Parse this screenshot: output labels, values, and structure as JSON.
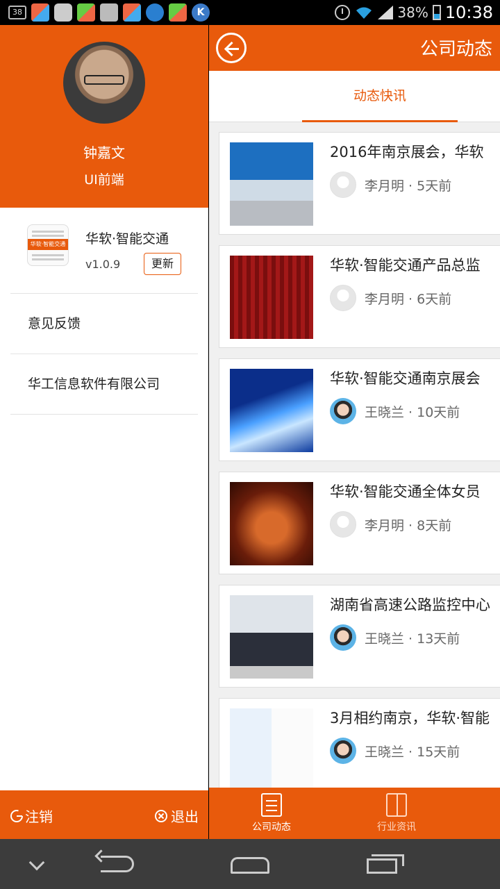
{
  "status_bar": {
    "notification_badge": "38",
    "battery": "38%",
    "time": "10:38",
    "k_icon": "K",
    "icons": [
      "app-icon",
      "chat-icon",
      "app-icon",
      "image-icon",
      "app-icon",
      "cloud-icon",
      "app-icon",
      "k-icon",
      "alarm-icon",
      "wifi-icon",
      "signal-icon",
      "battery-icon"
    ]
  },
  "drawer": {
    "user_name": "钟嘉文",
    "user_role": "UI前端",
    "app_name": "华软·智能交通",
    "app_logo_text": "华软·智能交通",
    "version": "v1.0.9",
    "update_label": "更新",
    "menu": [
      "意见反馈",
      "华工信息软件有限公司"
    ],
    "logout_label": "注销",
    "exit_label": "退出"
  },
  "main": {
    "title": "公司动态",
    "tab_active": "动态快讯",
    "news": [
      {
        "title": "2016年南京展会，华软",
        "meta": "李月明 · 5天前",
        "avatar": "default"
      },
      {
        "title": "华软·智能交通产品总监",
        "meta": "李月明 · 6天前",
        "avatar": "default"
      },
      {
        "title": "华软·智能交通南京展会",
        "meta": "王晓兰 · 10天前",
        "avatar": "photo"
      },
      {
        "title": "华软·智能交通全体女员",
        "meta": "李月明 · 8天前",
        "avatar": "default"
      },
      {
        "title": "湖南省高速公路监控中心",
        "meta": "王晓兰 · 13天前",
        "avatar": "photo"
      },
      {
        "title": "3月相约南京，华软·智能",
        "meta": "王晓兰 · 15天前",
        "avatar": "photo"
      }
    ],
    "bottom_nav": [
      {
        "label": "公司动态",
        "icon": "document-icon",
        "active": true
      },
      {
        "label": "行业资讯",
        "icon": "book-icon",
        "active": false
      }
    ]
  },
  "colors": {
    "accent": "#e85a0c",
    "background": "#f0f0f0",
    "system_bar": "#3c3c3c"
  }
}
